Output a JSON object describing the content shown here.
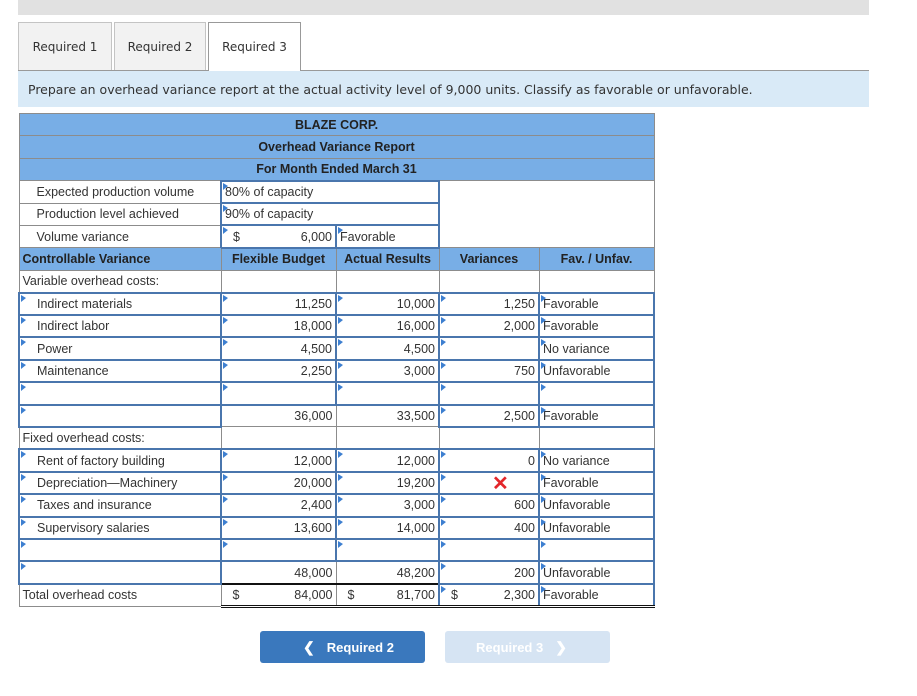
{
  "tabs": [
    {
      "label": "Required 1",
      "active": false
    },
    {
      "label": "Required 2",
      "active": false
    },
    {
      "label": "Required 3",
      "active": true
    }
  ],
  "instruction": "Prepare an overhead variance report at the actual activity level of 9,000 units. Classify as favorable or unfavorable.",
  "report": {
    "company": "BLAZE CORP.",
    "title": "Overhead Variance Report",
    "period": "For Month Ended March 31",
    "volume": {
      "expected_label": "Expected production volume",
      "expected_value": "80% of capacity",
      "achieved_label": "Production level achieved",
      "achieved_value": "90% of capacity",
      "variance_label": "Volume variance",
      "variance_currency": "$",
      "variance_amount": "6,000",
      "variance_class": "Favorable"
    },
    "columns": {
      "section": "Controllable Variance",
      "flexible": "Flexible Budget",
      "actual": "Actual Results",
      "variances": "Variances",
      "fav": "Fav. / Unfav."
    },
    "variable_heading": "Variable overhead costs:",
    "variable_rows": [
      {
        "label": "Indirect materials",
        "flexible": "11,250",
        "actual": "10,000",
        "variance": "1,250",
        "fav": "Favorable"
      },
      {
        "label": "Indirect labor",
        "flexible": "18,000",
        "actual": "16,000",
        "variance": "2,000",
        "fav": "Favorable"
      },
      {
        "label": "Power",
        "flexible": "4,500",
        "actual": "4,500",
        "variance": "",
        "fav": "No variance"
      },
      {
        "label": "Maintenance",
        "flexible": "2,250",
        "actual": "3,000",
        "variance": "750",
        "fav": "Unfavorable"
      },
      {
        "label": "",
        "flexible": "",
        "actual": "",
        "variance": "",
        "fav": ""
      }
    ],
    "variable_total": {
      "label": "",
      "flexible": "36,000",
      "actual": "33,500",
      "variance": "2,500",
      "fav": "Favorable"
    },
    "fixed_heading": "Fixed overhead costs:",
    "fixed_rows": [
      {
        "label": "Rent of factory building",
        "flexible": "12,000",
        "actual": "12,000",
        "variance": "0",
        "fav": "No variance"
      },
      {
        "label": "Depreciation—Machinery",
        "flexible": "20,000",
        "actual": "19,200",
        "variance": "",
        "fav": "Favorable",
        "error": true
      },
      {
        "label": "Taxes and insurance",
        "flexible": "2,400",
        "actual": "3,000",
        "variance": "600",
        "fav": "Unfavorable"
      },
      {
        "label": "Supervisory salaries",
        "flexible": "13,600",
        "actual": "14,000",
        "variance": "400",
        "fav": "Unfavorable"
      },
      {
        "label": "",
        "flexible": "",
        "actual": "",
        "variance": "",
        "fav": ""
      }
    ],
    "fixed_total": {
      "label": "",
      "flexible": "48,000",
      "actual": "48,200",
      "variance": "200",
      "fav": "Unfavorable"
    },
    "grand_total": {
      "label": "Total overhead costs",
      "currency": "$",
      "flexible": "84,000",
      "actual": "81,700",
      "variance": "2,300",
      "fav": "Favorable"
    }
  },
  "nav": {
    "prev_label": "Required 2",
    "next_label": "Required 3",
    "prev_icon": "chevron-left-icon",
    "next_icon": "chevron-right-icon"
  },
  "colors": {
    "header_blue": "#78aee6",
    "input_border": "#4a76ad",
    "instruction_bg": "#d9eaf7",
    "error_red": "#e3262b",
    "button_primary": "#3a78bd",
    "button_disabled": "#d6e4f3"
  }
}
